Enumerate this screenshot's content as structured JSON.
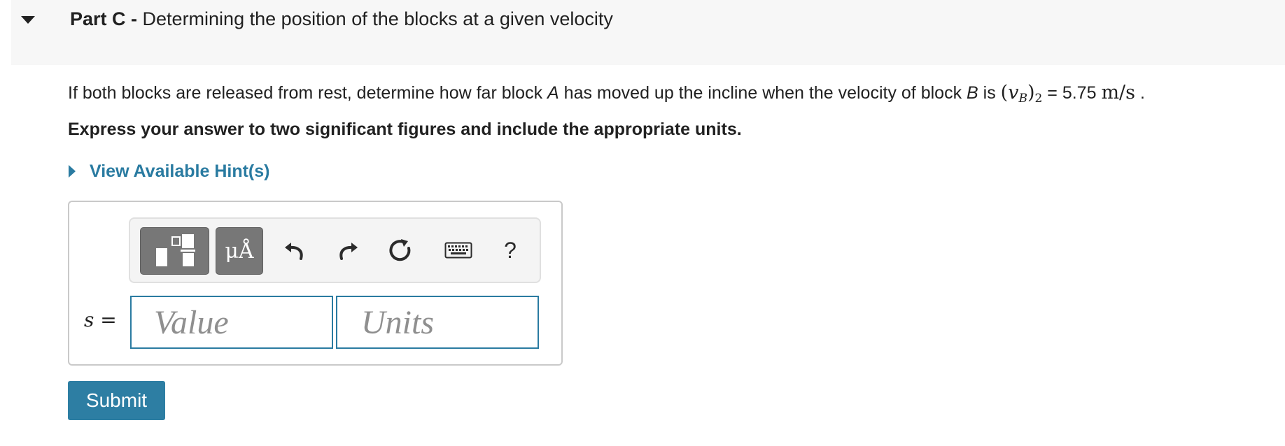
{
  "part": {
    "label": "Part C",
    "separator": " - ",
    "title": "Determining the position of the blocks at a given velocity"
  },
  "question": {
    "text_1": "If both blocks are released from rest, determine how far block ",
    "block_a": "A",
    "text_2": " has moved up the incline when the velocity of block ",
    "block_b": "B",
    "text_3": " is ",
    "math_open": "(",
    "math_var": "v",
    "math_sub": "B",
    "math_close": ")",
    "math_index": "2",
    "equals_value": " = 5.75 ",
    "unit": "m/s",
    "period": " ."
  },
  "instruction": "Express your answer to two significant figures and include the appropriate units.",
  "hint": {
    "label": "View Available Hint(s)"
  },
  "toolbar": {
    "templates_icon": "templates-icon",
    "units_label": "μÅ",
    "undo_icon": "undo-icon",
    "redo_icon": "redo-icon",
    "reset_icon": "reset-icon",
    "keyboard_icon": "keyboard-icon",
    "help_label": "?"
  },
  "answer": {
    "variable": "s",
    "equals": " =",
    "value_placeholder": "Value",
    "units_placeholder": "Units"
  },
  "submit": {
    "label": "Submit"
  },
  "colors": {
    "link": "#2a7ba1",
    "submit_bg": "#2d7ea3",
    "toolbar_button": "#777777",
    "header_bg": "#f7f7f7"
  }
}
